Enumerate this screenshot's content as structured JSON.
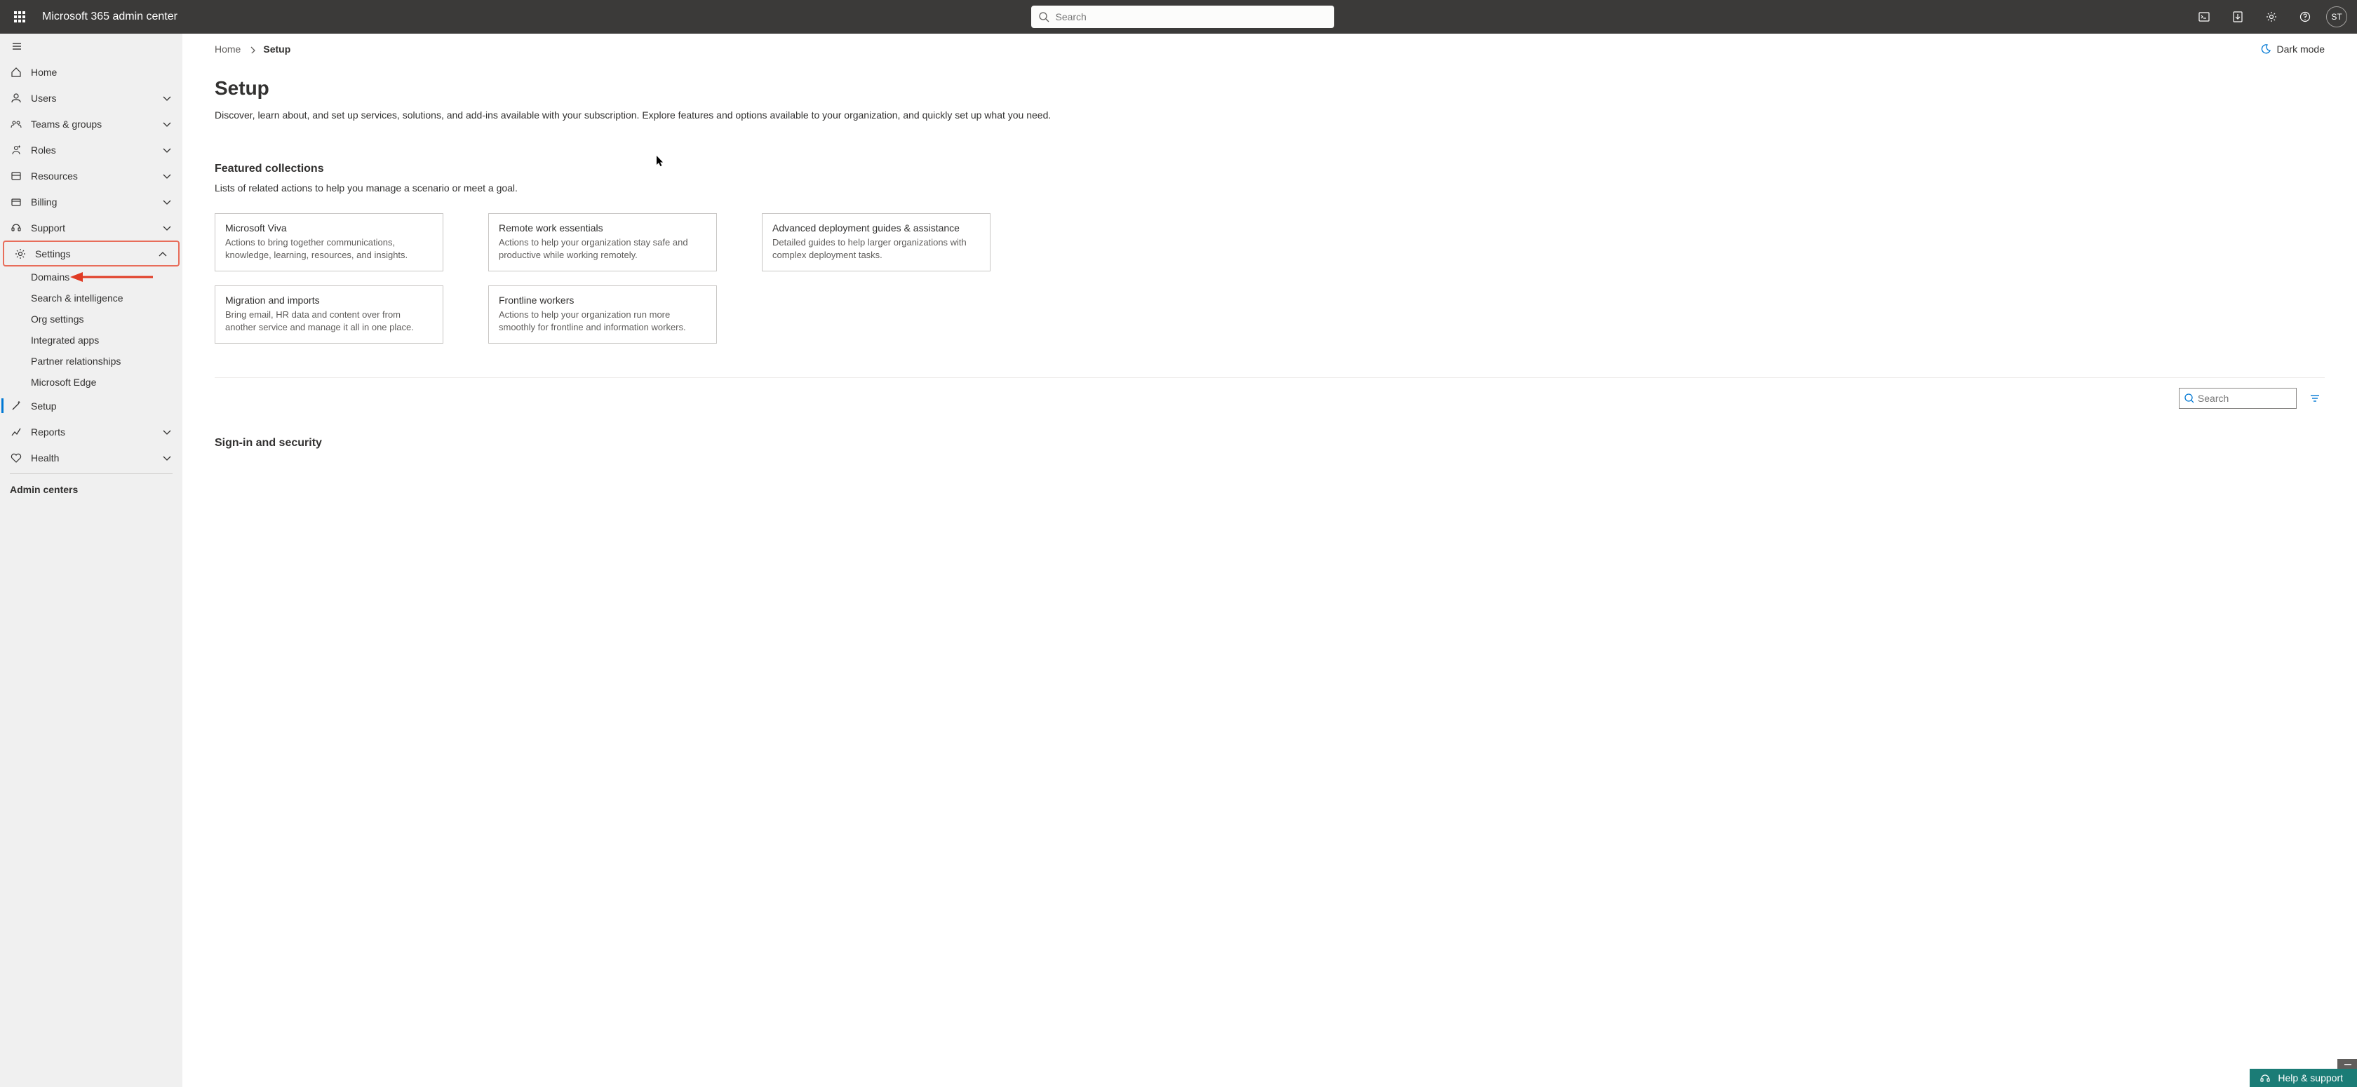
{
  "topbar": {
    "app_title": "Microsoft 365 admin center",
    "search_placeholder": "Search",
    "avatar_initials": "ST"
  },
  "breadcrumb": {
    "home": "Home",
    "current": "Setup"
  },
  "darkmode_label": "Dark mode",
  "page": {
    "title": "Setup",
    "description": "Discover, learn about, and set up services, solutions, and add-ins available with your subscription. Explore features and options available to your organization, and quickly set up what you need."
  },
  "featured": {
    "title": "Featured collections",
    "subtitle": "Lists of related actions to help you manage a scenario or meet a goal.",
    "cards": [
      {
        "title": "Microsoft Viva",
        "desc": "Actions to bring together communications, knowledge, learning, resources, and insights."
      },
      {
        "title": "Remote work essentials",
        "desc": "Actions to help your organization stay safe and productive while working remotely."
      },
      {
        "title": "Advanced deployment guides & assistance",
        "desc": "Detailed guides to help larger organizations with complex deployment tasks."
      },
      {
        "title": "Migration and imports",
        "desc": "Bring email, HR data and content over from another service and manage it all in one place."
      },
      {
        "title": "Frontline workers",
        "desc": "Actions to help your organization run more smoothly for frontline and information workers."
      }
    ]
  },
  "local_search_placeholder": "Search",
  "signin_section_title": "Sign-in and security",
  "sidebar": {
    "home": "Home",
    "users": "Users",
    "teams": "Teams & groups",
    "roles": "Roles",
    "resources": "Resources",
    "billing": "Billing",
    "support": "Support",
    "settings": "Settings",
    "settings_children": {
      "domains": "Domains",
      "search_intel": "Search & intelligence",
      "org_settings": "Org settings",
      "integrated_apps": "Integrated apps",
      "partner": "Partner relationships",
      "edge": "Microsoft Edge"
    },
    "setup": "Setup",
    "reports": "Reports",
    "health": "Health",
    "admin_centers": "Admin centers"
  },
  "help_button": "Help & support"
}
